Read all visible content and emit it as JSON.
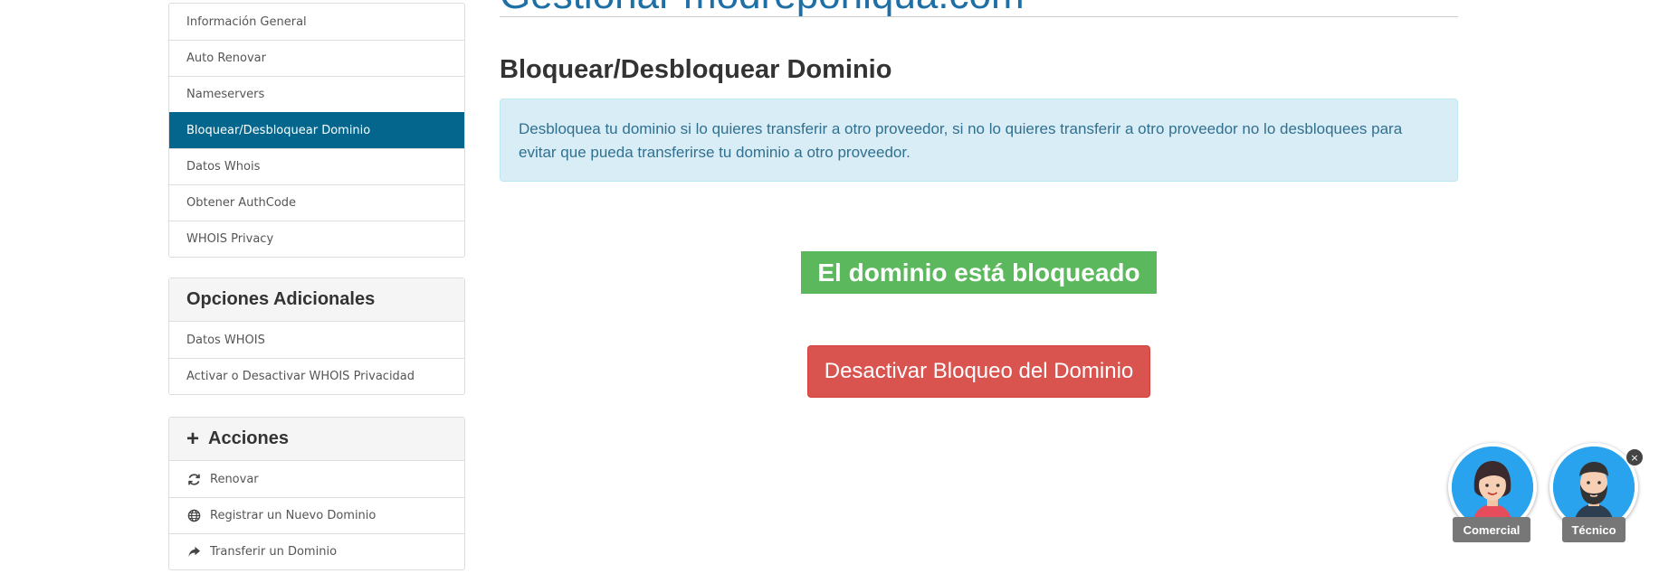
{
  "page": {
    "title": "Gestionar modreponiqua.com",
    "section_title": "Bloquear/Desbloquear Dominio",
    "info_text": "Desbloquea tu dominio si lo quieres transferir a otro proveedor, si no lo quieres transferir a otro proveedor no lo desbloquees para evitar que pueda transferirse tu dominio a otro proveedor.",
    "status_text": "El dominio está bloqueado",
    "action_button": "Desactivar Bloqueo del Dominio"
  },
  "sidebar": {
    "manage_items": [
      {
        "label": "Información General"
      },
      {
        "label": "Auto Renovar"
      },
      {
        "label": "Nameservers"
      },
      {
        "label": "Bloquear/Desbloquear Dominio"
      },
      {
        "label": "Datos Whois"
      },
      {
        "label": "Obtener AuthCode"
      },
      {
        "label": "WHOIS Privacy"
      }
    ],
    "additional": {
      "heading": "Opciones Adicionales",
      "items": [
        {
          "label": "Datos WHOIS"
        },
        {
          "label": "Activar o Desactivar WHOIS Privacidad"
        }
      ]
    },
    "actions": {
      "heading": "Acciones",
      "items": [
        {
          "label": "Renovar",
          "icon": "refresh-icon"
        },
        {
          "label": "Registrar un Nuevo Dominio",
          "icon": "globe-icon"
        },
        {
          "label": "Transferir un Dominio",
          "icon": "share-arrow-icon"
        }
      ]
    }
  },
  "chat": {
    "commercial_label": "Comercial",
    "technical_label": "Técnico",
    "close": "×"
  },
  "colors": {
    "active_item": "#05668d",
    "status_green": "#5cb85c",
    "danger_red": "#d9534f",
    "info_bg": "#d9edf7",
    "chat_blue": "#2aa3ee"
  }
}
